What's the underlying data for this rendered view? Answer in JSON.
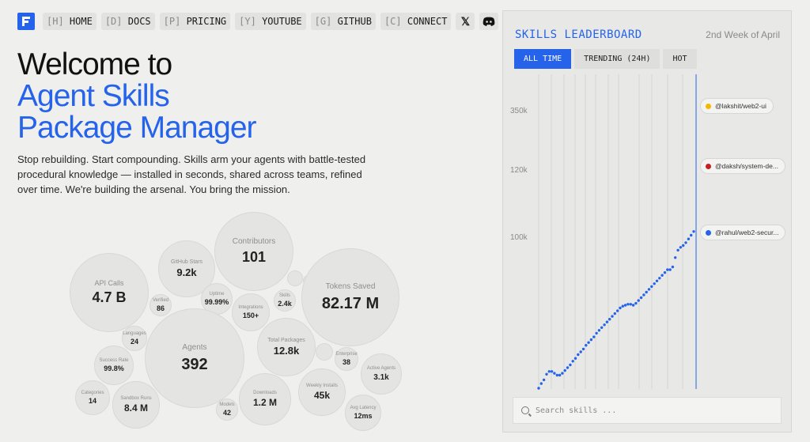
{
  "nav": {
    "items": [
      {
        "key": "[H]",
        "label": "HOME"
      },
      {
        "key": "[D]",
        "label": "DOCS"
      },
      {
        "key": "[P]",
        "label": "PRICING"
      },
      {
        "key": "[Y]",
        "label": "YOUTUBE"
      },
      {
        "key": "[G]",
        "label": "GITHUB"
      },
      {
        "key": "[C]",
        "label": "CONNECT"
      }
    ],
    "x_icon": "𝕏"
  },
  "hero": {
    "line1": "Welcome to",
    "line2": "Agent Skills",
    "line3": "Package Manager",
    "description": "Stop rebuilding. Start compounding. Skills arm your agents with battle-tested procedural knowledge — installed in seconds, shared across teams, refined over time. We're building the arsenal. You bring the mission."
  },
  "stats": [
    {
      "label": "Contributors",
      "value": "101"
    },
    {
      "label": "GitHub Stars",
      "value": "9.2k"
    },
    {
      "label": "API Calls",
      "value": "4.7 B"
    },
    {
      "label": "Tokens Saved",
      "value": "82.17 M"
    },
    {
      "label": "Uptime",
      "value": "99.99%"
    },
    {
      "label": "Verified",
      "value": "86"
    },
    {
      "label": "Integrations",
      "value": "150+"
    },
    {
      "label": "Skills",
      "value": "2.4k"
    },
    {
      "label": "Languages",
      "value": "24"
    },
    {
      "label": "Agents",
      "value": "392"
    },
    {
      "label": "Total Packages",
      "value": "12.8k"
    },
    {
      "label": "Success Rate",
      "value": "99.8%"
    },
    {
      "label": "Enterprise",
      "value": "38"
    },
    {
      "label": "Active Agents",
      "value": "3.1k"
    },
    {
      "label": "Categories",
      "value": "14"
    },
    {
      "label": "Sandbox Runs",
      "value": "8.4 M"
    },
    {
      "label": "Weekly Installs",
      "value": "45k"
    },
    {
      "label": "Downloads",
      "value": "1.2 M"
    },
    {
      "label": "Models",
      "value": "42"
    },
    {
      "label": "Avg Latency",
      "value": "12ms"
    }
  ],
  "leaderboard": {
    "title": "SKILLS LEADERBOARD",
    "week": "2nd Week of April",
    "tabs": [
      {
        "label": "ALL TIME",
        "active": true
      },
      {
        "label": "TRENDING (24H)",
        "active": false
      },
      {
        "label": "HOT",
        "active": false
      }
    ],
    "entries": [
      {
        "name": "@lakshit/web2-ui",
        "color": "#f5b800"
      },
      {
        "name": "@daksh/system-de...",
        "color": "#c81e1e"
      },
      {
        "name": "@rahul/web2-secur...",
        "color": "#2563eb"
      }
    ],
    "search_placeholder": "Search skills ..."
  },
  "chart_data": {
    "type": "line",
    "ytick_labels": [
      "350k",
      "120k",
      "100k"
    ],
    "series": [
      {
        "values": [
          0.0,
          0.05,
          0.09,
          0.15,
          0.18,
          0.18,
          0.16,
          0.14,
          0.14,
          0.16,
          0.19,
          0.22,
          0.25,
          0.29,
          0.32,
          0.36,
          0.39,
          0.42,
          0.46,
          0.49,
          0.52,
          0.55,
          0.59,
          0.62,
          0.65,
          0.68,
          0.71,
          0.74,
          0.77,
          0.8,
          0.83,
          0.86,
          0.88,
          0.89,
          0.9,
          0.9,
          0.89,
          0.91,
          0.94,
          0.97,
          1.0,
          1.03,
          1.06,
          1.09,
          1.12,
          1.15,
          1.18,
          1.21,
          1.24,
          1.27,
          1.27,
          1.3,
          1.4,
          1.48,
          1.51,
          1.53,
          1.56,
          1.6,
          1.64,
          1.68
        ]
      }
    ],
    "grid": true
  },
  "colors": {
    "accent": "#2563eb",
    "line": "#2563eb"
  }
}
